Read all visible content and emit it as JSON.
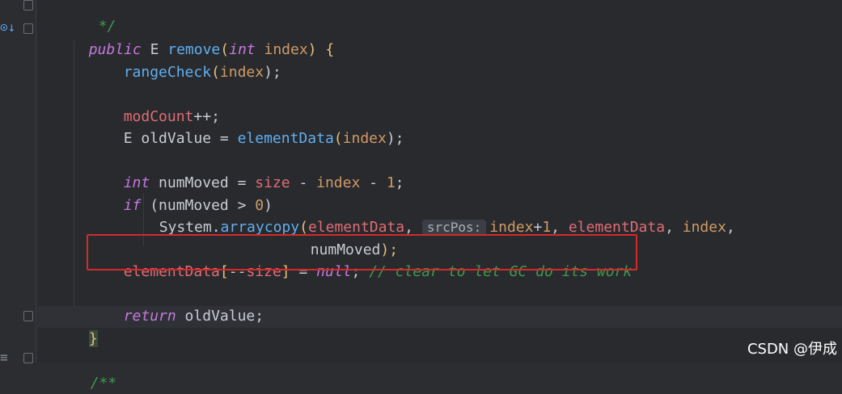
{
  "editor": {
    "lines": {
      "comment_end": "*/",
      "signature": {
        "kw_public": "public",
        "type_e": "E",
        "method": "remove",
        "open": "(",
        "kw_int": "int",
        "param": "index",
        "close": ")",
        "brace": "{"
      },
      "range_check": {
        "fn": "rangeCheck",
        "open": "(",
        "arg": "index",
        "close": ");"
      },
      "mod_count": {
        "field": "modCount",
        "rest": "++;"
      },
      "old_value": {
        "type": "E oldValue = ",
        "fn": "elementData",
        "open": "(",
        "arg": "index",
        "close": ");"
      },
      "num_moved": {
        "kw_int": "int",
        "var": " numMoved = ",
        "field": "size",
        "op1": " - ",
        "arg": "index",
        "op2": " - ",
        "num": "1",
        "end": ";"
      },
      "if_stmt": {
        "kw_if": "if",
        "rest": " (numMoved > ",
        "num": "0",
        "close": ")"
      },
      "arraycopy": {
        "cls": "System.",
        "fn": "arraycopy",
        "open": "(",
        "arg1": "elementData",
        "sep1": ", ",
        "hint": "srcPos:",
        "arg2": "index",
        "plus": "+",
        "num": "1",
        "sep2": ", ",
        "arg3": "elementData",
        "sep3": ", ",
        "arg4": "index",
        "sep4": ","
      },
      "arraycopy_cont": {
        "text": "numMoved",
        "close": ");"
      },
      "clear_line": {
        "field": "elementData",
        "bracket_open": "[",
        "op": "--",
        "field2": "size",
        "bracket_close": "]",
        "eq": " = ",
        "kw_null": "null",
        "semi": ";",
        "comment": "// clear to let GC do its work"
      },
      "return_stmt": {
        "kw_return": "return",
        "rest": " oldValue;"
      },
      "close_brace": "}",
      "doc_start": "/**"
    }
  },
  "gutter": {
    "icons": [
      "override-icon",
      "fold-icon"
    ]
  },
  "watermark": "CSDN @伊成",
  "colors": {
    "background": "#282a2e",
    "keyword": "#c678dd",
    "function": "#61afef",
    "field": "#e06c75",
    "parameter": "#d19a66",
    "comment": "#3f9950",
    "highlight_box": "#d42a2a"
  }
}
